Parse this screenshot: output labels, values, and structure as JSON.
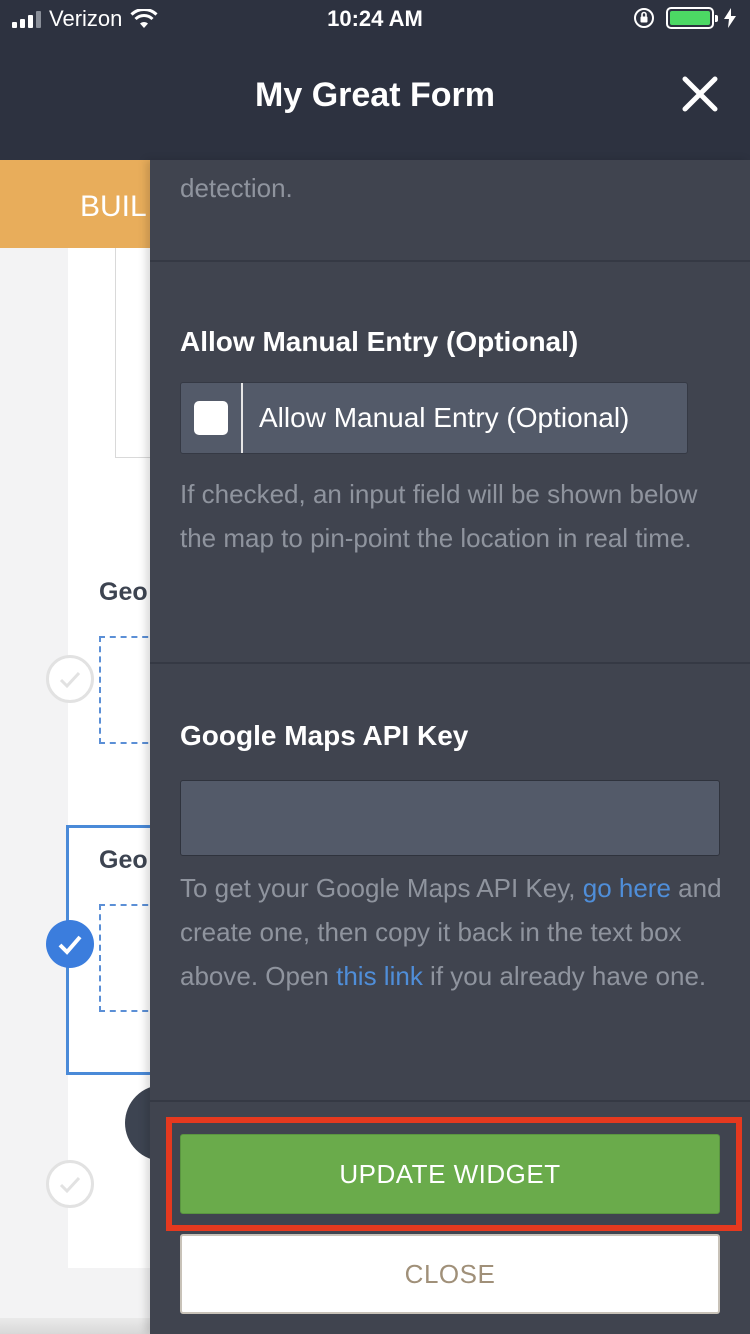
{
  "status_bar": {
    "carrier": "Verizon",
    "time": "10:24 AM",
    "battery_color": "#4cd964"
  },
  "header": {
    "title": "My Great Form",
    "close_icon": "close-x-icon"
  },
  "background": {
    "builder_tab_label": "BUIL",
    "widget_label_1": "Geo",
    "widget_label_2": "Geo",
    "accent_color": "#e8ad5b"
  },
  "panel": {
    "detection_text": "detection.",
    "manual_entry": {
      "heading": "Allow Manual Entry (Optional)",
      "checkbox_label": "Allow Manual Entry (Optional)",
      "checked": false,
      "help_text": "If checked, an input field will be shown below the map to pin-point the location in real time."
    },
    "api_key": {
      "heading": "Google Maps API Key",
      "value": "",
      "help_part1": "To get your Google Maps API Key, ",
      "link1": "go here",
      "help_part2": " and create one, then copy it back in the text box above. Open ",
      "link2": "this link",
      "help_part3": " if you already have one."
    },
    "buttons": {
      "update": "UPDATE WIDGET",
      "close": "CLOSE",
      "update_color": "#6aab4b",
      "highlight_color": "#e5391f"
    }
  }
}
